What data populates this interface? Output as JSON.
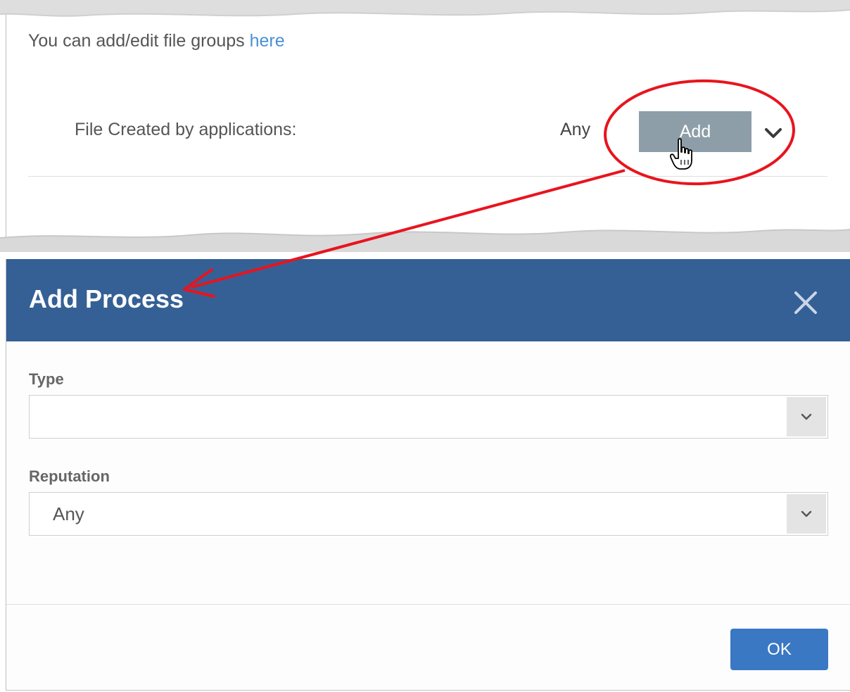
{
  "snippet": {
    "info_text": "You can add/edit file groups ",
    "info_link": "here",
    "field_label": "File Created by applications:",
    "field_value": "Any",
    "add_button": "Add"
  },
  "dialog": {
    "title": "Add Process",
    "type_label": "Type",
    "type_value": "",
    "reputation_label": "Reputation",
    "reputation_value": "Any",
    "ok_button": "OK"
  },
  "colors": {
    "header": "#356096",
    "ok_button": "#3a78c3",
    "add_button": "#8e9ea8",
    "annotation": "#e8141e",
    "link": "#4a90d6"
  },
  "icons": [
    "chevron-down-icon",
    "hand-pointer-icon",
    "close-icon"
  ]
}
